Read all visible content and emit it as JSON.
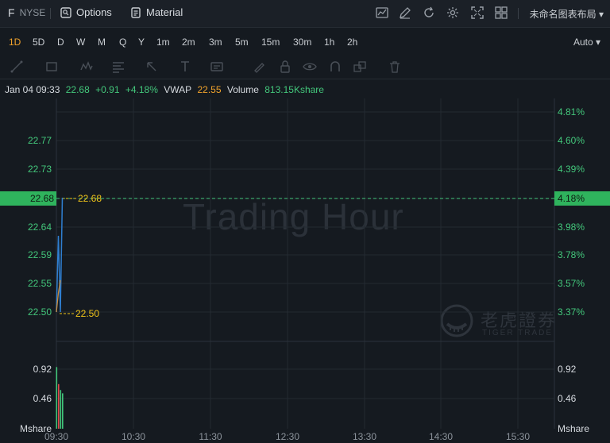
{
  "topbar": {
    "symbol": "F",
    "exchange": "NYSE",
    "options_label": "Options",
    "material_label": "Material",
    "layout_name": "未命名图表布局 ▾"
  },
  "periods": [
    "1D",
    "5D",
    "D",
    "W",
    "M",
    "Q",
    "Y",
    "1m",
    "2m",
    "3m",
    "5m",
    "15m",
    "30m",
    "1h",
    "2h"
  ],
  "active_period": "1D",
  "auto_label": "Auto ▾",
  "info": {
    "datetime": "Jan 04 09:33",
    "price": "22.68",
    "change": "+0.91",
    "change_pct": "+4.18%",
    "vwap_label": "VWAP",
    "vwap_value": "22.55",
    "volume_label": "Volume",
    "volume_value": "813.15Kshare"
  },
  "chart_data": {
    "type": "line",
    "price_axis_left": [
      "22.77",
      "22.73",
      "22.68",
      "22.64",
      "22.59",
      "22.55",
      "22.50"
    ],
    "price_axis_right": [
      "4.81%",
      "4.60%",
      "4.39%",
      "4.18%",
      "3.98%",
      "3.78%",
      "3.57%",
      "3.37%"
    ],
    "current_price_label": "22.68",
    "current_pct_label": "4.18%",
    "high_marker": "22.68",
    "low_marker": "22.50",
    "time_labels": [
      "09:30",
      "10:30",
      "11:30",
      "12:30",
      "13:30",
      "14:30",
      "15:30"
    ],
    "volume_axis": [
      "0.92",
      "0.46"
    ],
    "volume_unit": "Mshare",
    "price_series": [
      {
        "time": "09:30",
        "price": 22.5
      },
      {
        "time": "09:31",
        "price": 22.62
      },
      {
        "time": "09:32",
        "price": 22.5
      },
      {
        "time": "09:33",
        "price": 22.68
      }
    ],
    "vwap_series": [
      {
        "time": "09:30",
        "price": 22.5
      },
      {
        "time": "09:31",
        "price": 22.53
      },
      {
        "time": "09:32",
        "price": 22.55
      }
    ],
    "volume_bars": [
      {
        "time": "09:30",
        "value": 0.94,
        "color": "#43c77b"
      },
      {
        "time": "09:31",
        "value": 0.68,
        "color": "#e0484c"
      },
      {
        "time": "09:32",
        "value": 0.59,
        "color": "#43c77b"
      },
      {
        "time": "09:33",
        "value": 0.54,
        "color": "#43c77b"
      }
    ],
    "colors": {
      "price_line": "#2f7fd1",
      "vwap_line": "#c98a3a",
      "up": "#43c77b",
      "down": "#e0484c",
      "marker": "#f0c419"
    }
  },
  "watermark": "Trading Hour",
  "brand": {
    "name": "老虎證券",
    "sub": "TIGER TRADE"
  }
}
